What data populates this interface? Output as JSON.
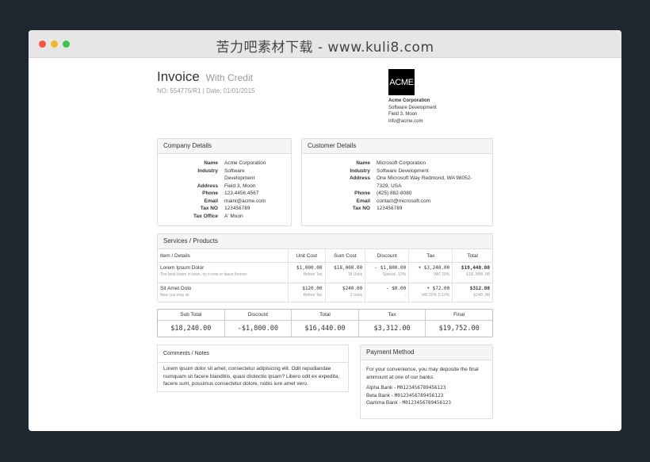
{
  "window": {
    "title": "苦力吧素材下载 - www.kuli8.com"
  },
  "invoice": {
    "title": "Invoice",
    "subtitle": "With Credit",
    "number_line": "NO: 554775/R1 | Date: 01/01/2015",
    "logo_text": "ACME",
    "company_name": "Acme Corporation",
    "company_lines": [
      "Software Development",
      "Field 3, Moon",
      "info@acme.com"
    ]
  },
  "company_details": {
    "heading": "Company Details",
    "rows": [
      {
        "k": "Name",
        "v": "Acme Corporation"
      },
      {
        "k": "Industry",
        "v": "Software"
      },
      {
        "k": "",
        "v": "Development"
      },
      {
        "k": "Address",
        "v": "Field 3, Moon"
      },
      {
        "k": "Phone",
        "v": "123.4456.4567"
      },
      {
        "k": "Email",
        "v": "mainl@acme.com"
      },
      {
        "k": "Tax NO",
        "v": "123456789"
      },
      {
        "k": "Tax Office",
        "v": "A' Moon"
      }
    ]
  },
  "customer_details": {
    "heading": "Customer Details",
    "rows": [
      {
        "k": "Name",
        "v": "Microsoft Corporation"
      },
      {
        "k": "Industry",
        "v": "Software Development"
      },
      {
        "k": "Address",
        "v": "One Microsoft Way Redmond, WA 98052-"
      },
      {
        "k": "",
        "v": "7329, USA"
      },
      {
        "k": "Phone",
        "v": "(425) 882-8080"
      },
      {
        "k": "Email",
        "v": "contact@microsoft.com"
      },
      {
        "k": "Tax NO",
        "v": "123456789"
      }
    ]
  },
  "services": {
    "heading": "Services / Products",
    "columns": [
      "Item / Details",
      "Unit Cost",
      "Sum Cost",
      "Discount",
      "Tax",
      "Total"
    ],
    "rows": [
      {
        "name": "Lorem Ipsum Dolor",
        "desc": "The best lorem in town, try it now or leave forever",
        "unit": "$1,000.00",
        "unit_note": "Before Tax",
        "sum": "$18,000.00",
        "sum_note": "18 Units",
        "disc": "- $1,800.00",
        "disc_note": "Special -10%",
        "tax": "+ $3,240.00",
        "tax_note": "VAT 20%",
        "total": "$19,440.00",
        "total_note": "$18,000.00"
      },
      {
        "name": "Sit Amet Dolo",
        "desc": "Now you may sit",
        "unit": "$120.00",
        "unit_note": "Before Tax",
        "sum": "$240.00",
        "sum_note": "2 Units",
        "disc": "- $0.00",
        "disc_note": "-",
        "tax": "+ $72.00",
        "tax_note": "VAT:20% S:10%",
        "total": "$312.00",
        "total_note": "$240.00"
      }
    ]
  },
  "summary": [
    {
      "label": "Sub Total",
      "value": "$18,240.00"
    },
    {
      "label": "Discount",
      "value": "-$1,800.00"
    },
    {
      "label": "Total",
      "value": "$16,440.00"
    },
    {
      "label": "Tax",
      "value": "$3,312.00"
    },
    {
      "label": "Final",
      "value": "$19,752.00"
    }
  ],
  "comments": {
    "heading": "Comments / Notes",
    "text": "Lorem ipsum dolor sit amet, consectetur adipisicing elit. Odit repudiandae numquam sit facere blanditiis, quasi distinctio ipsam? Libero odit ex expedita, facere sunt, possimus consectetur dolore, nobis iure amet vero."
  },
  "payment": {
    "heading": "Payment Method",
    "intro": "For your convenience, you may deposite the final ammount at one of our banks",
    "banks": [
      {
        "name": "Alpha Bank",
        "account": "M0123456789456123"
      },
      {
        "name": "Beta Bank",
        "account": "M0123456789456123"
      },
      {
        "name": "Gamma Bank",
        "account": "M0123456789456123"
      }
    ]
  }
}
